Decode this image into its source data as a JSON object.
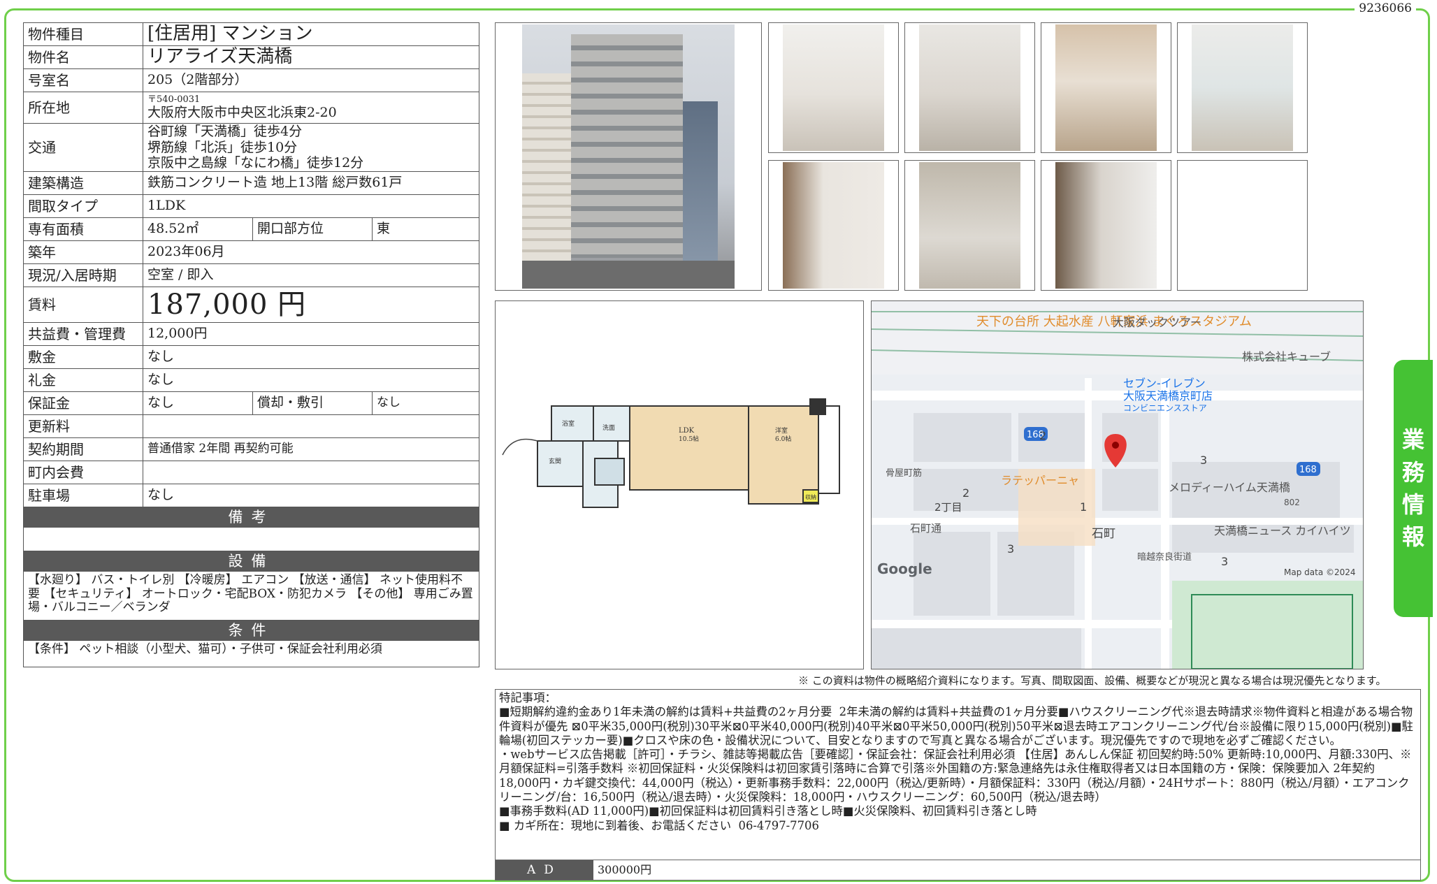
{
  "doc_number": "9236066",
  "property": {
    "type_label": "物件種目",
    "type_value": "[住居用]  マンション",
    "name_label": "物件名",
    "name_value": "リアライズ天満橋",
    "room_label": "号室名",
    "room_value": "205（2階部分）",
    "address_label": "所在地",
    "postal": "〒540-0031",
    "address_value": "大阪府大阪市中央区北浜東2-20",
    "transit_label": "交通",
    "transit": [
      "谷町線「天満橋」徒歩4分",
      "堺筋線「北浜」徒歩10分",
      "京阪中之島線「なにわ橋」徒歩12分"
    ],
    "structure_label": "建築構造",
    "structure_value": "鉄筋コンクリート造 地上13階 総戸数61戸",
    "layout_label": "間取タイプ",
    "layout_value": "1LDK",
    "area_label": "専有面積",
    "area_value": "48.52㎡",
    "direction_label": "開口部方位",
    "direction_value": "東",
    "built_label": "築年",
    "built_value": "2023年06月",
    "status_label": "現況/入居時期",
    "status_value": "空室 /  即入",
    "rent_label": "賃料",
    "rent_value": "187,000 円",
    "fee_label": "共益費・管理費",
    "fee_value": "12,000円",
    "deposit_label": "敷金",
    "deposit_value": "なし",
    "key_money_label": "礼金",
    "key_money_value": "なし",
    "guarantee_label": "保証金",
    "guarantee_value": "なし",
    "amortization_label": "償却・敷引",
    "amortization_value": "なし",
    "renewal_label": "更新料",
    "renewal_value": "",
    "contract_label": "契約期間",
    "contract_value": "普通借家 2年間 再契約可能",
    "community_label": "町内会費",
    "community_value": "",
    "parking_label": "駐車場",
    "parking_value": "なし"
  },
  "sections": {
    "remarks_title": "備考",
    "remarks_text": "",
    "equipment_title": "設備",
    "equipment_text": "【水廻り】 バス・トイレ別 【冷暖房】 エアコン 【放送・通信】 ネット使用料不要 【セキュリティ】 オートロック・宅配BOX・防犯カメラ 【その他】 専用ごみ置場・バルコニー／ベランダ",
    "conditions_title": "条件",
    "conditions_text": "【条件】 ペット相談（小型犬、猫可）・子供可・保証会社利用必須"
  },
  "floor_plan": {
    "ldk": "LDK",
    "ldk_size": "10.5帖",
    "western": "洋室",
    "western_size": "6.0帖",
    "bath": "浴室",
    "washroom": "洗面",
    "entrance": "玄関",
    "storage": "収納"
  },
  "map": {
    "labels": {
      "restaurant": "天下の台所 大起水産 八軒家浜 まぐろスタジアム",
      "tour": "大阪ダックツアー",
      "company": "株式会社キューブ",
      "seven_eleven": "セブン-イレブン",
      "seven_branch": "大阪天満橋京町店",
      "store_type": "コンビニエンスストア",
      "route": "168",
      "cafe": "ラテッパーニャ",
      "melody": "メロディーハイム天満橋",
      "tenmabashi_heights": "天満橋ニュース カイハイツ",
      "ishimachi_street": "石町通",
      "ishimachi": "石町",
      "nichome": "2丁目",
      "kurumamachi": "骨屋町筋",
      "sakaisuji": "暗越奈良街道",
      "block_802": "802",
      "num_2a": "2",
      "num_2b": "2",
      "num_1": "1",
      "num_3a": "3",
      "num_3b": "3",
      "num_3c": "3",
      "google": "Google",
      "map_data": "Map data ©2024"
    }
  },
  "disclaimer": "※ この資料は物件の概略紹介資料になります。写真、間取図面、設備、概要などが現況と異なる場合は現況優先となります。",
  "special_notes": [
    "特記事項：",
    "■短期解約違約金あり1年未満の解約は賃料+共益費の2ヶ月分要  2年未満の解約は賃料+共益費の1ヶ月分要■ハウスクリーニング代※退去時請求※物件資料と相違がある場合物件資料が優先 ⊠0平米35,000円(税別)30平米⊠0平米40,000円(税別)40平米⊠0平米50,000円(税別)50平米⊠退去時エアコンクリーニング代/台※設備に限り15,000円(税別)■駐輪場(初回ステッカー要)■クロスや床の色・設備状況について、目安となりますので写真と異なる場合がございます。現況優先ですので現地を必ずご確認ください。",
    "・webサービス広告掲載［許可］・チラシ、雑誌等掲載広告［要確認］・保証会社：保証会社利用必須 【住居】あんしん保証 初回契約時:50% 更新時:10,000円、月額:330円、※月額保証料=引落手数料 ※初回保証料・火災保険料は初回家賃引落時に合算で引落※外国籍の方:緊急連絡先は永住権取得者又は日本国籍の方・保険：保険要加入 2年契約 18,000円・カギ鍵交換代：44,000円（税込）・更新事務手数料：22,000円（税込/更新時）・月額保証料：330円（税込/月額）・24Hサポート：880円（税込/月額）・エアコンクリーニング/台：16,500円（税込/退去時）・火災保険料：18,000円・ハウスクリーニング：60,500円（税込/退去時）",
    "■事務手数料(AD 11,000円)■初回保証料は初回賃料引き落とし時■火災保険料、初回賃料引き落とし時",
    "■ カギ所在：現地に到着後、お電話ください  06-4797-7706"
  ],
  "ad": {
    "label": "AD",
    "value": "300000円"
  },
  "side_tab": [
    "業",
    "務",
    "情",
    "報"
  ]
}
